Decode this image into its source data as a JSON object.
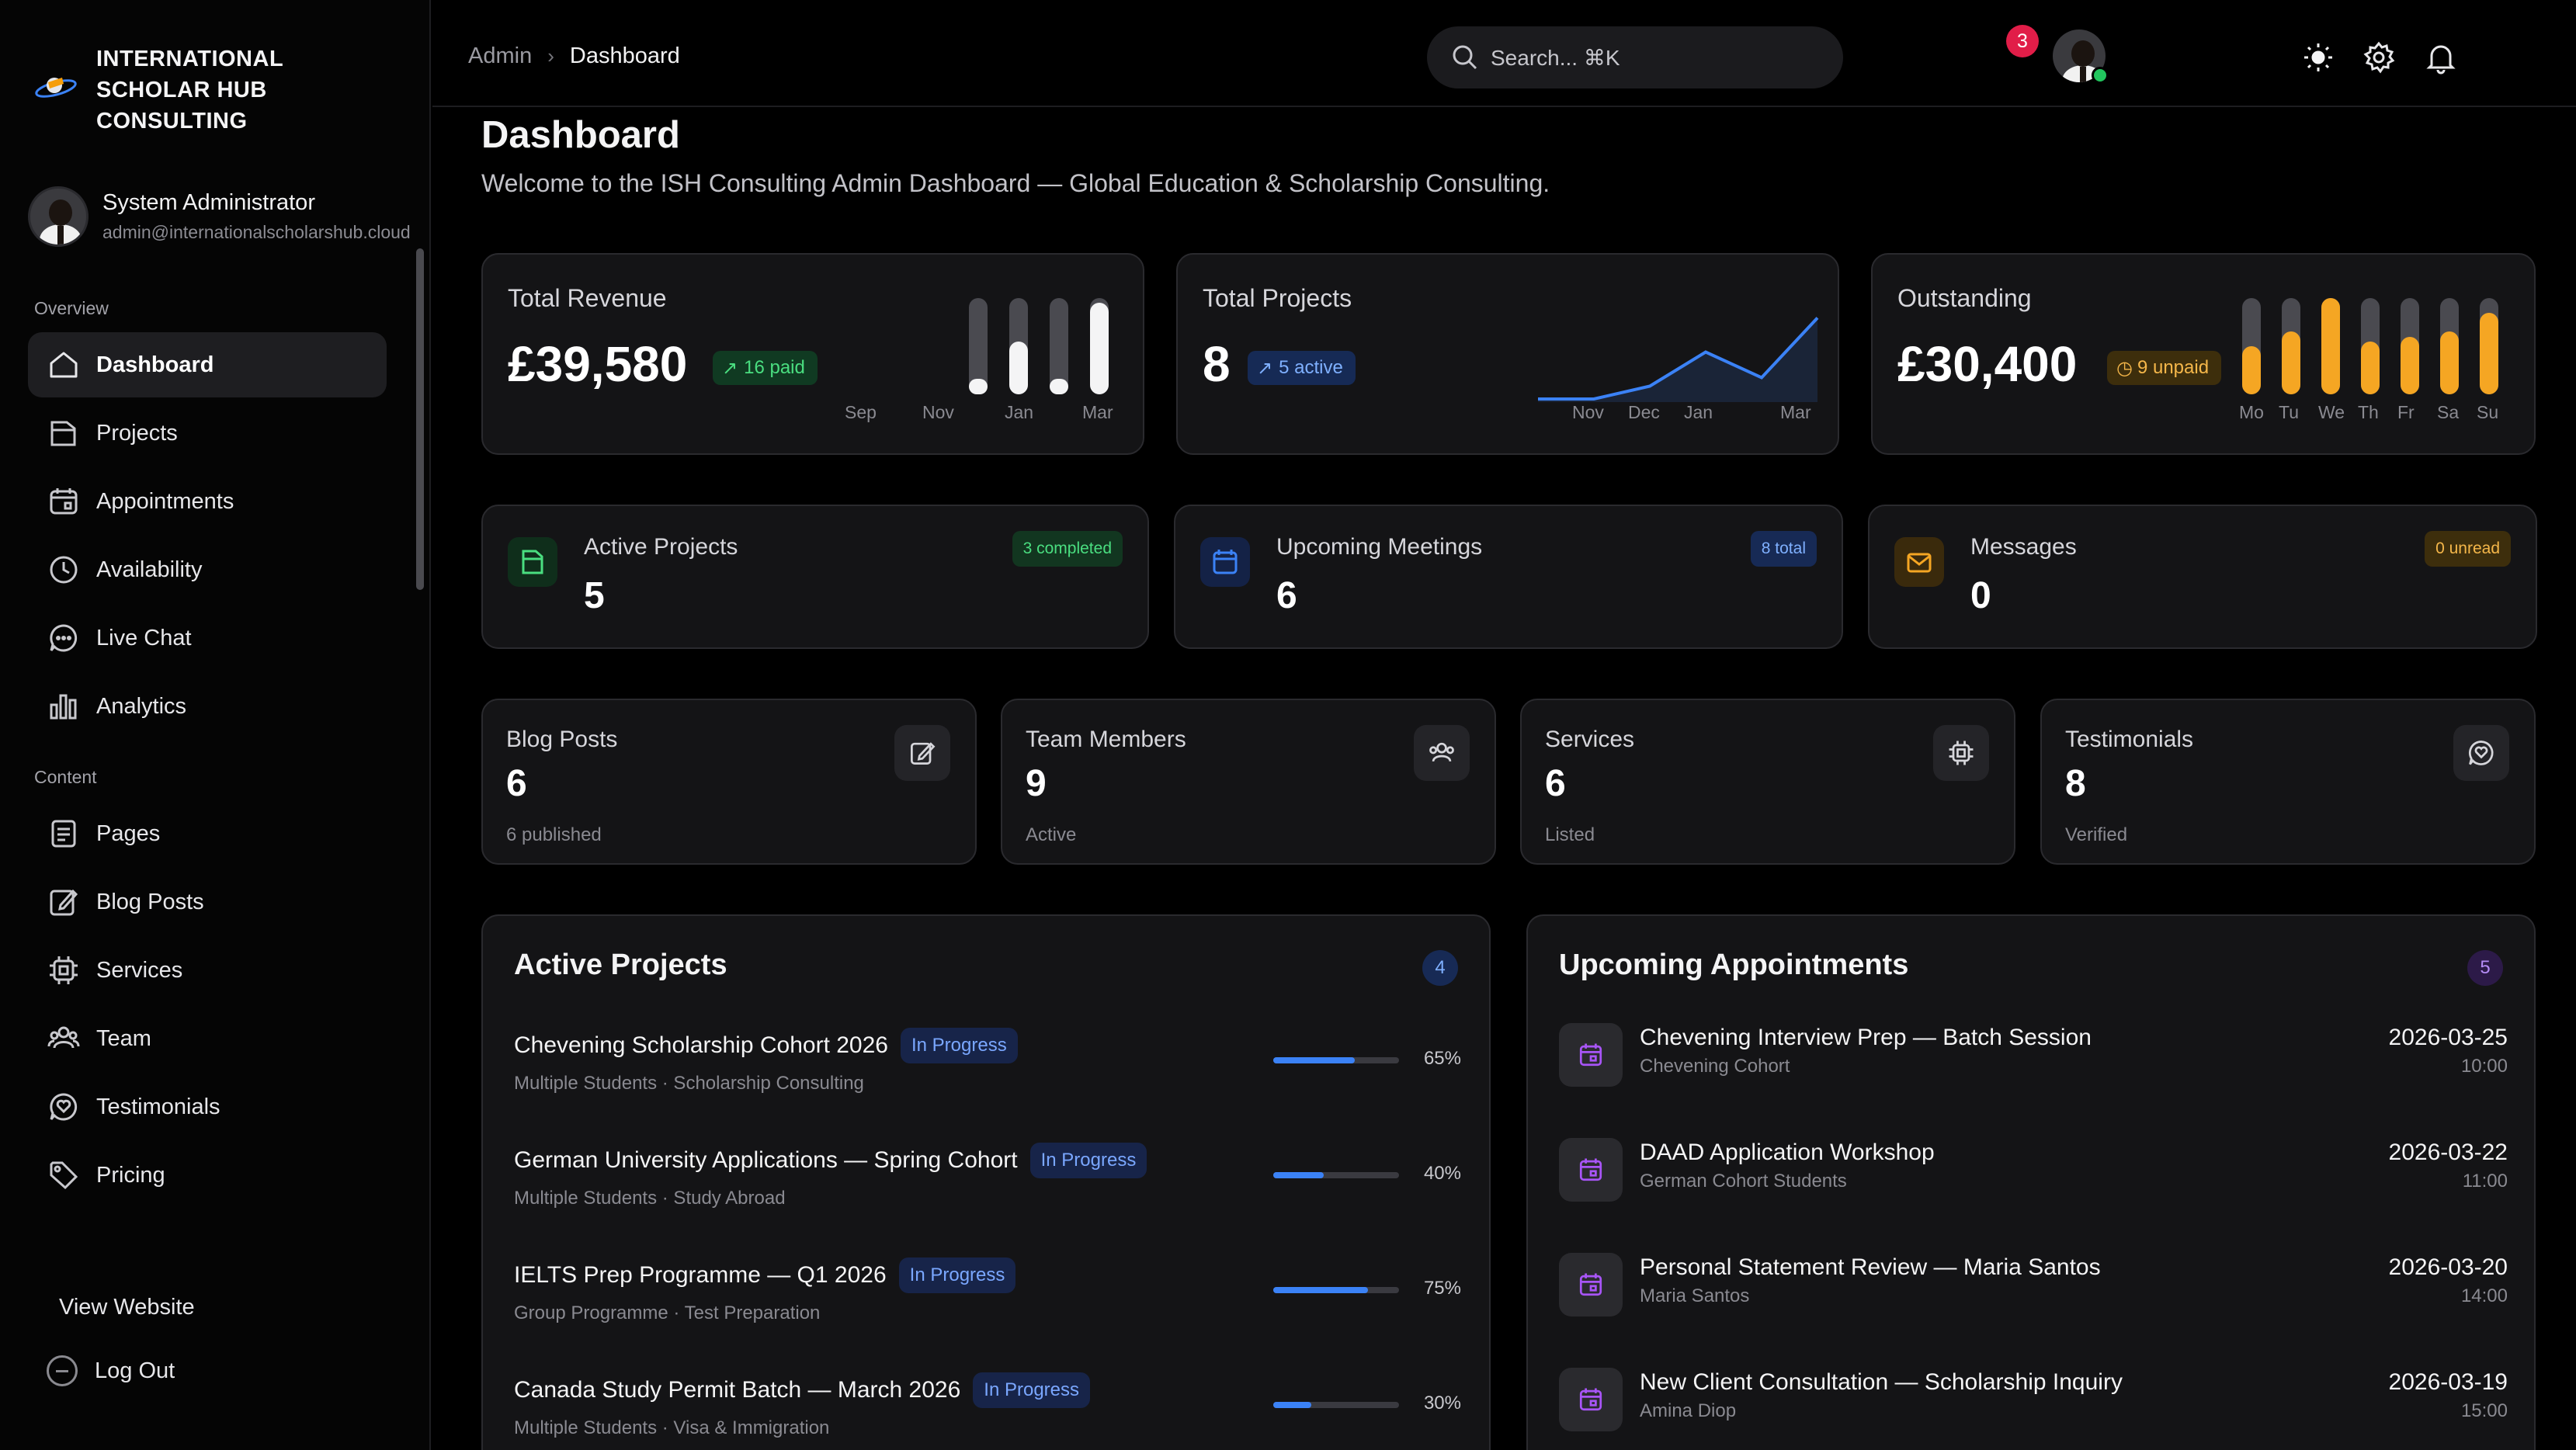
{
  "brand": {
    "name": "INTERNATIONAL SCHOLAR HUB CONSULTING"
  },
  "user": {
    "name": "System Administrator",
    "email": "admin@internationalscholarshub.cloud"
  },
  "sidebar": {
    "overview_label": "Overview",
    "content_label": "Content",
    "overview_items": [
      {
        "label": "Dashboard",
        "icon": "home-icon",
        "active": true
      },
      {
        "label": "Projects",
        "icon": "folder-icon"
      },
      {
        "label": "Appointments",
        "icon": "calendar-icon"
      },
      {
        "label": "Availability",
        "icon": "clock-icon"
      },
      {
        "label": "Live Chat",
        "icon": "chat-icon"
      },
      {
        "label": "Analytics",
        "icon": "bar-chart-icon"
      }
    ],
    "content_items": [
      {
        "label": "Pages",
        "icon": "document-icon"
      },
      {
        "label": "Blog Posts",
        "icon": "edit-icon"
      },
      {
        "label": "Services",
        "icon": "chip-icon"
      },
      {
        "label": "Team",
        "icon": "users-icon"
      },
      {
        "label": "Testimonials",
        "icon": "heart-chat-icon"
      },
      {
        "label": "Pricing",
        "icon": "tag-icon"
      }
    ],
    "view_website": "View Website",
    "logout": "Log Out"
  },
  "topbar": {
    "breadcrumb_root": "Admin",
    "breadcrumb_current": "Dashboard",
    "search_placeholder": "Search... ⌘K",
    "notification_count": "3"
  },
  "page": {
    "title": "Dashboard",
    "subtitle": "Welcome to the ISH Consulting Admin Dashboard — Global Education & Scholarship Consulting."
  },
  "stats": {
    "revenue": {
      "label": "Total Revenue",
      "value": "£39,580",
      "pill": "16 paid",
      "chart_labels": [
        "Sep",
        "Nov",
        "Jan",
        "Mar"
      ],
      "bars": [
        0,
        0.15,
        0.55,
        0.15,
        0.95
      ]
    },
    "projects": {
      "label": "Total Projects",
      "value": "8",
      "pill": "5 active",
      "chart_labels": [
        "Nov",
        "Dec",
        "Jan",
        "Mar"
      ],
      "line": [
        0,
        0,
        0.15,
        0.55,
        0.25,
        0.95
      ]
    },
    "outstanding": {
      "label": "Outstanding",
      "value": "£30,400",
      "pill": "9 unpaid",
      "chart_labels": [
        "Mo",
        "Tu",
        "We",
        "Th",
        "Fr",
        "Sa",
        "Su"
      ],
      "bars": [
        0.5,
        0.65,
        1.0,
        0.55,
        0.6,
        0.65,
        0.85
      ]
    }
  },
  "metrics": [
    {
      "label": "Active Projects",
      "value": "5",
      "tag": "3 completed",
      "icon": "folder-icon"
    },
    {
      "label": "Upcoming Meetings",
      "value": "6",
      "tag": "8 total",
      "icon": "calendar-icon"
    },
    {
      "label": "Messages",
      "value": "0",
      "tag": "0 unread",
      "icon": "mail-icon"
    }
  ],
  "summary": [
    {
      "label": "Blog Posts",
      "value": "6",
      "sub": "6 published",
      "icon": "edit-icon"
    },
    {
      "label": "Team Members",
      "value": "9",
      "sub": "Active",
      "icon": "users-icon"
    },
    {
      "label": "Services",
      "value": "6",
      "sub": "Listed",
      "icon": "chip-icon"
    },
    {
      "label": "Testimonials",
      "value": "8",
      "sub": "Verified",
      "icon": "heart-chat-icon"
    }
  ],
  "active_projects": {
    "title": "Active Projects",
    "count": "4",
    "items": [
      {
        "name": "Chevening Scholarship Cohort 2026",
        "status": "In Progress",
        "meta": "Multiple Students · Scholarship Consulting",
        "progress": 0.65,
        "pct": "65%"
      },
      {
        "name": "German University Applications — Spring Cohort",
        "status": "In Progress",
        "meta": "Multiple Students · Study Abroad",
        "progress": 0.4,
        "pct": "40%"
      },
      {
        "name": "IELTS Prep Programme — Q1 2026",
        "status": "In Progress",
        "meta": "Group Programme · Test Preparation",
        "progress": 0.75,
        "pct": "75%"
      },
      {
        "name": "Canada Study Permit Batch — March 2026",
        "status": "In Progress",
        "meta": "Multiple Students · Visa & Immigration",
        "progress": 0.3,
        "pct": "30%"
      }
    ]
  },
  "appointments": {
    "title": "Upcoming Appointments",
    "count": "5",
    "items": [
      {
        "title": "Chevening Interview Prep — Batch Session",
        "sub": "Chevening Cohort",
        "date": "2026-03-25",
        "time": "10:00"
      },
      {
        "title": "DAAD Application Workshop",
        "sub": "German Cohort Students",
        "date": "2026-03-22",
        "time": "11:00"
      },
      {
        "title": "Personal Statement Review — Maria Santos",
        "sub": "Maria Santos",
        "date": "2026-03-20",
        "time": "14:00"
      },
      {
        "title": "New Client Consultation — Scholarship Inquiry",
        "sub": "Amina Diop",
        "date": "2026-03-19",
        "time": "15:00"
      }
    ]
  },
  "colors": {
    "accent_blue": "#3b82f6",
    "amber": "#f5a623",
    "green": "#4ade80",
    "purple": "#a855f7"
  }
}
